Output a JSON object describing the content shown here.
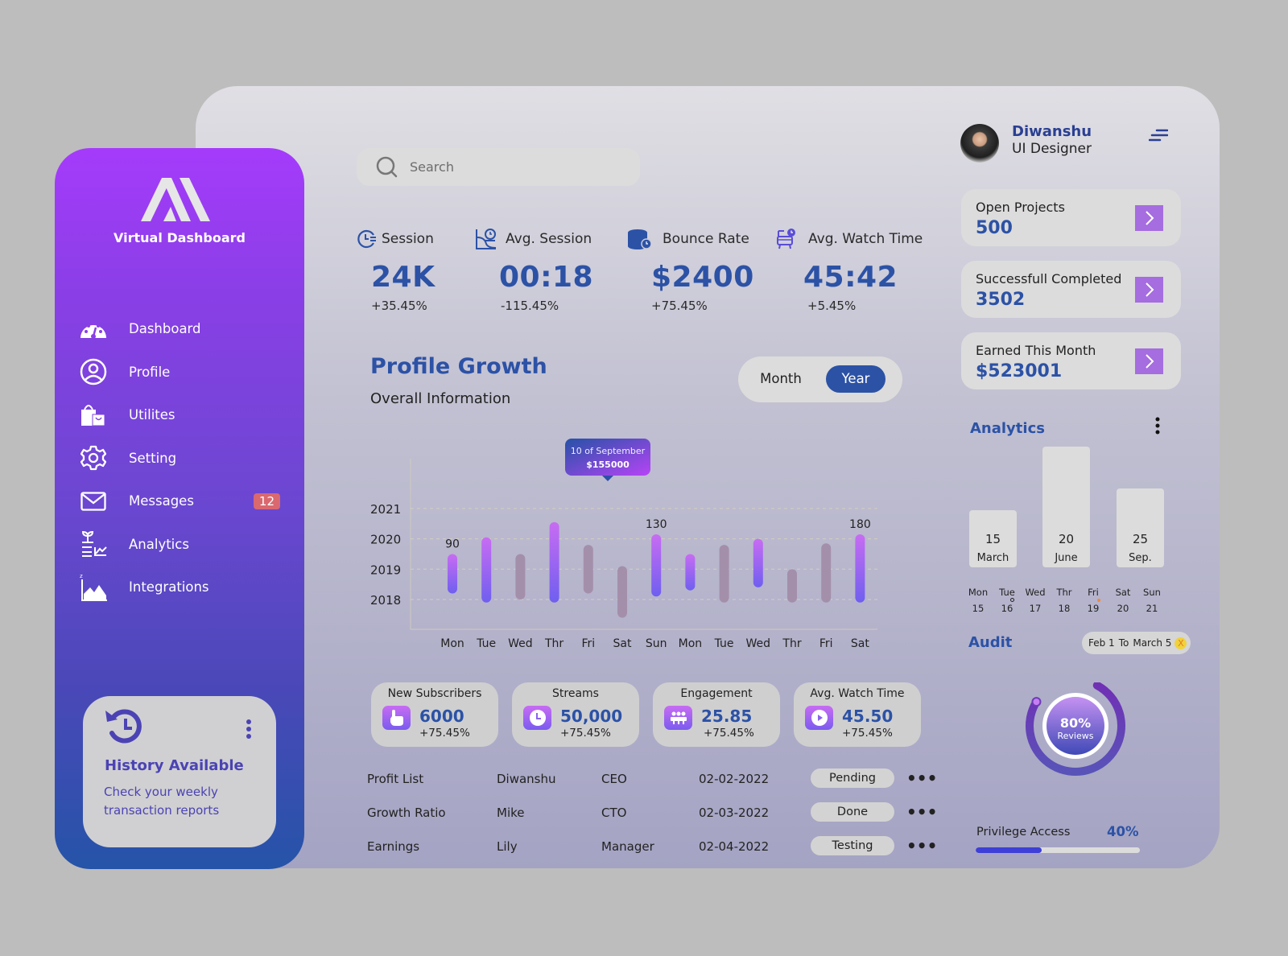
{
  "brand": {
    "name": "Virtual Dashboard"
  },
  "sidebar": {
    "items": [
      {
        "label": "Dashboard",
        "icon": "speedometer-icon"
      },
      {
        "label": "Profile",
        "icon": "user-circle-icon"
      },
      {
        "label": "Utilites",
        "icon": "shopping-bags-icon"
      },
      {
        "label": "Setting",
        "icon": "gear-icon"
      },
      {
        "label": "Messages",
        "icon": "envelope-icon",
        "badge": "12"
      },
      {
        "label": "Analytics",
        "icon": "plant-chart-icon"
      },
      {
        "label": "Integrations",
        "icon": "area-chart-icon"
      }
    ],
    "history_card": {
      "title": "History Available",
      "description": "Check your weekly transaction reports"
    }
  },
  "search": {
    "placeholder": "Search",
    "value": ""
  },
  "stats": [
    {
      "label": "Session",
      "value": "24K",
      "change": "+35.45%",
      "icon": "clock-lines-icon"
    },
    {
      "label": "Avg. Session",
      "value": "00:18",
      "change": "-115.45%",
      "icon": "chart-clock-icon"
    },
    {
      "label": "Bounce Rate",
      "value": "$2400",
      "change": "+75.45%",
      "icon": "database-clock-icon"
    },
    {
      "label": "Avg. Watch Time",
      "value": "45:42",
      "change": "+5.45%",
      "icon": "tv-clock-icon"
    }
  ],
  "profile_growth": {
    "title": "Profile Growth",
    "subtitle": "Overall Information",
    "toggle": {
      "options": [
        "Month",
        "Year"
      ],
      "selected": "Year"
    },
    "tooltip": {
      "date": "10 of September",
      "amount": "$155000"
    }
  },
  "chart_data": {
    "type": "bar",
    "title": "Profile Growth",
    "subtitle": "Overall Information",
    "categories": [
      "Mon",
      "Tue",
      "Wed",
      "Thr",
      "Fri",
      "Sat",
      "Sun",
      "Mon",
      "Tue",
      "Wed",
      "Thr",
      "Fri",
      "Sat"
    ],
    "y_tick_labels": [
      "2018",
      "2019",
      "2020",
      "2021"
    ],
    "ranges": [
      {
        "low": 2018.2,
        "high": 2019.5,
        "highlighted": true,
        "label": "90"
      },
      {
        "low": 2017.9,
        "high": 2020.05,
        "highlighted": true
      },
      {
        "low": 2018.0,
        "high": 2019.5,
        "highlighted": false
      },
      {
        "low": 2017.9,
        "high": 2020.55,
        "highlighted": true
      },
      {
        "low": 2018.2,
        "high": 2019.8,
        "highlighted": false
      },
      {
        "low": 2017.4,
        "high": 2019.1,
        "highlighted": false
      },
      {
        "low": 2018.1,
        "high": 2020.15,
        "highlighted": true,
        "label": "130"
      },
      {
        "low": 2018.3,
        "high": 2019.5,
        "highlighted": true
      },
      {
        "low": 2017.9,
        "high": 2019.8,
        "highlighted": false
      },
      {
        "low": 2018.4,
        "high": 2020.0,
        "highlighted": true
      },
      {
        "low": 2017.9,
        "high": 2019.0,
        "highlighted": false
      },
      {
        "low": 2017.9,
        "high": 2019.85,
        "highlighted": false
      },
      {
        "low": 2017.9,
        "high": 2020.15,
        "highlighted": true,
        "label": "180"
      }
    ],
    "ylim": [
      2017.0,
      2022.0
    ],
    "grid": true,
    "tooltip": {
      "category_index": 4,
      "text": "10 of September",
      "value": "$155000"
    }
  },
  "mini_cards": [
    {
      "title": "New Subscribers",
      "value": "6000",
      "change": "+75.45%",
      "icon": "hand-pointer-icon"
    },
    {
      "title": "Streams",
      "value": "50,000",
      "change": "+75.45%",
      "icon": "clock-icon"
    },
    {
      "title": "Engagement",
      "value": "25.85",
      "change": "+75.45%",
      "icon": "group-icon"
    },
    {
      "title": "Avg. Watch Time",
      "value": "45.50",
      "change": "+75.45%",
      "icon": "play-icon"
    }
  ],
  "table": {
    "rows": [
      {
        "name": "Profit List",
        "person": "Diwanshu",
        "role": "CEO",
        "date": "02-02-2022",
        "status": "Pending"
      },
      {
        "name": "Growth Ratio",
        "person": "Mike",
        "role": "CTO",
        "date": "02-03-2022",
        "status": "Done"
      },
      {
        "name": "Earnings",
        "person": "Lily",
        "role": "Manager",
        "date": "02-04-2022",
        "status": "Testing"
      }
    ],
    "more_label": "•••"
  },
  "user": {
    "name": "Diwanshu",
    "role": "UI Designer"
  },
  "info_cards": [
    {
      "label": "Open Projects",
      "value": "500"
    },
    {
      "label": "Successfull Completed",
      "value": "3502"
    },
    {
      "label": "Earned This Month",
      "value": "$523001"
    }
  ],
  "analytics": {
    "title": "Analytics",
    "bars": [
      {
        "value": "15",
        "month": "March",
        "level": 0.47
      },
      {
        "value": "20",
        "month": "June",
        "level": 1.0
      },
      {
        "value": "25",
        "month": "Sep.",
        "level": 0.65
      }
    ],
    "days": [
      {
        "name": "Mon",
        "date": "15"
      },
      {
        "name": "Tue",
        "date": "16",
        "active": true
      },
      {
        "name": "Wed",
        "date": "17"
      },
      {
        "name": "Thr",
        "date": "18"
      },
      {
        "name": "Fri",
        "date": "19",
        "marker": true
      },
      {
        "name": "Sat",
        "date": "20"
      },
      {
        "name": "Sun",
        "date": "21"
      }
    ]
  },
  "audit": {
    "title": "Audit",
    "date_range": {
      "from": "Feb 1",
      "to_label": "To",
      "to": "March 5",
      "clear": "X"
    },
    "gauge": {
      "value": "80%",
      "label": "Reviews",
      "percent": 80
    }
  },
  "privilege": {
    "label": "Privilege Access",
    "value": "40%",
    "percent": 40
  },
  "colors": {
    "accent": "#2c52a6",
    "sidebar_top": "#a53bfb",
    "sidebar_bottom": "#2554a8",
    "badge": "#d9686f",
    "bar_highlight_top": "#c86cf2",
    "bar_highlight_bottom": "#6f5ff0",
    "bar_muted": "#a48fab"
  }
}
